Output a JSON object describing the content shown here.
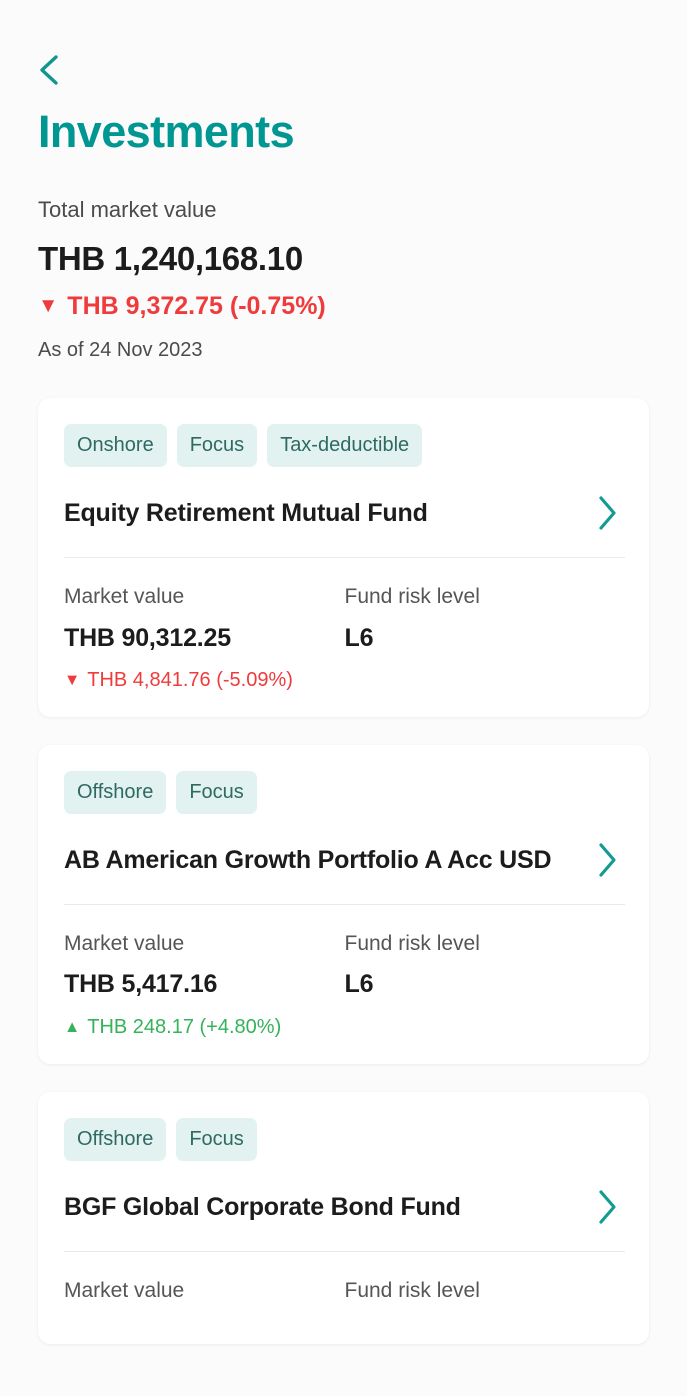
{
  "header": {
    "back_icon": "chevron-left-icon",
    "title": "Investments"
  },
  "summary": {
    "label": "Total market value",
    "value": "THB 1,240,168.10",
    "change_direction": "down",
    "change_arrow": "▼",
    "change_text": "THB 9,372.75 (-0.75%)",
    "as_of": "As of 24 Nov 2023"
  },
  "labels": {
    "market_value": "Market value",
    "fund_risk_level": "Fund risk level",
    "chevron_right_icon": "chevron-right-icon"
  },
  "colors": {
    "accent": "#009691",
    "chip_bg": "#e2f2f1",
    "chip_text": "#2f6a62",
    "negative": "#ef3b3b",
    "positive": "#34b35a",
    "page_bg": "#fbfbfb",
    "card_bg": "#ffffff"
  },
  "funds": [
    {
      "tags": [
        "Onshore",
        "Focus",
        "Tax-deductible"
      ],
      "name": "Equity Retirement Mutual Fund",
      "market_value_label": "Market value",
      "market_value": "THB 90,312.25",
      "change_direction": "down",
      "change_arrow": "▼",
      "change_text": "THB 4,841.76 (-5.09%)",
      "risk_label": "Fund risk level",
      "risk_level": "L6"
    },
    {
      "tags": [
        "Offshore",
        "Focus"
      ],
      "name": "AB American Growth Portfolio A Acc USD",
      "market_value_label": "Market value",
      "market_value": "THB 5,417.16",
      "change_direction": "up",
      "change_arrow": "▲",
      "change_text": "THB 248.17 (+4.80%)",
      "risk_label": "Fund risk level",
      "risk_level": "L6"
    },
    {
      "tags": [
        "Offshore",
        "Focus"
      ],
      "name": "BGF Global Corporate Bond Fund",
      "market_value_label": "Market value",
      "market_value": "",
      "change_direction": "none",
      "change_arrow": "",
      "change_text": "",
      "risk_label": "Fund risk level",
      "risk_level": ""
    }
  ]
}
